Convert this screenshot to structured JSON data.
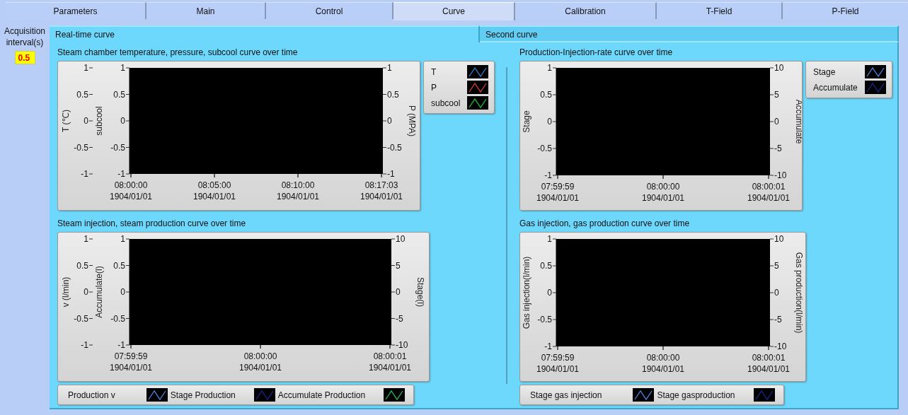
{
  "tabs": [
    {
      "label": "Parameters",
      "selected": false
    },
    {
      "label": "Main",
      "selected": false
    },
    {
      "label": "Control",
      "selected": false
    },
    {
      "label": "Curve",
      "selected": true
    },
    {
      "label": "Calibration",
      "selected": false
    },
    {
      "label": "T-Field",
      "selected": false
    },
    {
      "label": "P-Field",
      "selected": false
    }
  ],
  "acquisition": {
    "label": "Acquisition interval(s)",
    "value": "0.5"
  },
  "subtabs": [
    {
      "label": "Real-time curve",
      "selected": true
    },
    {
      "label": "Second curve",
      "selected": false
    }
  ],
  "graphs": [
    {
      "title": "Steam chamber temperature, pressure, subcool curve over time",
      "left_axes": [
        {
          "title": "T (℃)",
          "ticks": [
            "1",
            "0.5",
            "0",
            "-0.5",
            "-1"
          ]
        },
        {
          "title": "subcool",
          "ticks": [
            "1",
            "0.5",
            "0",
            "-0.5",
            "-1"
          ]
        }
      ],
      "right_axes": [
        {
          "title": "P (MPA)",
          "ticks": [
            "1",
            "0.5",
            "0",
            "-0.5",
            "-1"
          ]
        }
      ],
      "x_ticks": [
        {
          "time": "08:00:00",
          "date": "1904/01/01"
        },
        {
          "time": "08:05:00",
          "date": "1904/01/01"
        },
        {
          "time": "08:10:00",
          "date": "1904/01/01"
        },
        {
          "time": "08:17:03",
          "date": "1904/01/01"
        }
      ],
      "legend": {
        "kind": "side",
        "items": [
          {
            "name": "T",
            "color": "#2f7fd0"
          },
          {
            "name": "P",
            "color": "#d83a3a"
          },
          {
            "name": "subcool",
            "color": "#20c030"
          }
        ]
      }
    },
    {
      "title": "Production-Injection-rate curve over time",
      "left_axes": [
        {
          "title": "Stage",
          "ticks": [
            "1",
            "0.5",
            "0",
            "-0.5",
            "-1"
          ]
        }
      ],
      "right_axes": [
        {
          "title": "Accumulate",
          "ticks": [
            "10",
            "5",
            "0",
            "-5",
            "-10"
          ]
        }
      ],
      "x_ticks": [
        {
          "time": "07:59:59",
          "date": "1904/01/01"
        },
        {
          "time": "08:00:00",
          "date": "1904/01/01"
        },
        {
          "time": "08:00:01",
          "date": "1904/01/01"
        }
      ],
      "legend": {
        "kind": "side",
        "items": [
          {
            "name": "Stage",
            "color": "#4a88e0"
          },
          {
            "name": "Accumulate",
            "color": "#1a2590"
          }
        ]
      }
    },
    {
      "title": "Steam injection, steam production curve over time",
      "left_axes": [
        {
          "title": "v (l/min)",
          "ticks": [
            "1",
            "0.5",
            "0",
            "-0.5",
            "-1"
          ]
        },
        {
          "title": "Accumulate(l)",
          "ticks": [
            "1",
            "0.5",
            "0",
            "-0.5",
            "-1"
          ]
        }
      ],
      "right_axes": [
        {
          "title": "Stage(l)",
          "ticks": [
            "10",
            "5",
            "0",
            "-5",
            "-10"
          ]
        }
      ],
      "x_ticks": [
        {
          "time": "07:59:59",
          "date": "1904/01/01"
        },
        {
          "time": "08:00:00",
          "date": "1904/01/01"
        },
        {
          "time": "08:00:01",
          "date": "1904/01/01"
        }
      ],
      "legend": {
        "kind": "bottom",
        "items": [
          {
            "name": "Production v",
            "color": "#4a88e0"
          },
          {
            "name": "Stage Production",
            "color": "#1a2590"
          },
          {
            "name": "Accumulate Production",
            "color": "#20c050"
          }
        ]
      }
    },
    {
      "title": "Gas injection, gas production curve over time",
      "left_axes": [
        {
          "title": "Gas injection(l/min)",
          "ticks": [
            "1",
            "0.5",
            "0",
            "-0.5",
            "-1"
          ]
        }
      ],
      "right_axes": [
        {
          "title": "Gas production(l/min)",
          "ticks": [
            "10",
            "5",
            "0",
            "-5",
            "-10"
          ]
        }
      ],
      "x_ticks": [
        {
          "time": "07:59:59",
          "date": "1904/01/01"
        },
        {
          "time": "08:00:00",
          "date": "1904/01/01"
        },
        {
          "time": "08:00:01",
          "date": "1904/01/01"
        }
      ],
      "legend": {
        "kind": "bottom",
        "items": [
          {
            "name": "Stage gas injection",
            "color": "#4a88e0"
          },
          {
            "name": "Stage gasproduction",
            "color": "#1a2590"
          }
        ]
      }
    }
  ]
}
